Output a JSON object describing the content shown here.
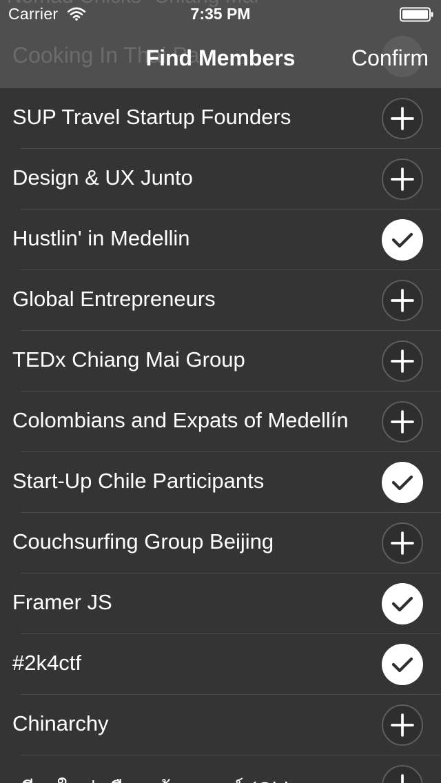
{
  "status_bar": {
    "carrier": "Carrier",
    "time": "7:35 PM"
  },
  "background_peek": {
    "top_text": "Nomad Chicks- Chiang Mai",
    "mid_text": "Cooking In Thai Pa"
  },
  "nav": {
    "title": "Find Members",
    "confirm_label": "Confirm"
  },
  "groups": [
    {
      "name": "SUP Travel Startup Founders",
      "state": "add"
    },
    {
      "name": "Design & UX Junto",
      "state": "add"
    },
    {
      "name": "Hustlin' in Medellin",
      "state": "joined"
    },
    {
      "name": "Global Entrepreneurs",
      "state": "add"
    },
    {
      "name": "TEDx Chiang Mai Group",
      "state": "add"
    },
    {
      "name": "Colombians and Expats of Medellín",
      "state": "add"
    },
    {
      "name": "Start-Up Chile Participants",
      "state": "joined"
    },
    {
      "name": "Couchsurfing Group Beijing",
      "state": "add"
    },
    {
      "name": "Framer JS",
      "state": "joined"
    },
    {
      "name": "#2k4ctf",
      "state": "joined"
    },
    {
      "name": "Chinarchy",
      "state": "add"
    },
    {
      "name": "เชียงใหม่ เมืองสร้างสรรค์ (Chiang",
      "state": "add"
    }
  ],
  "icons": {
    "add": "plus-icon",
    "joined": "checkmark-icon",
    "wifi": "wifi-icon",
    "battery": "battery-icon"
  },
  "colors": {
    "background": "#343434",
    "header": "#4f4f4f",
    "separator": "#4b4b4b",
    "text": "#ffffff"
  }
}
